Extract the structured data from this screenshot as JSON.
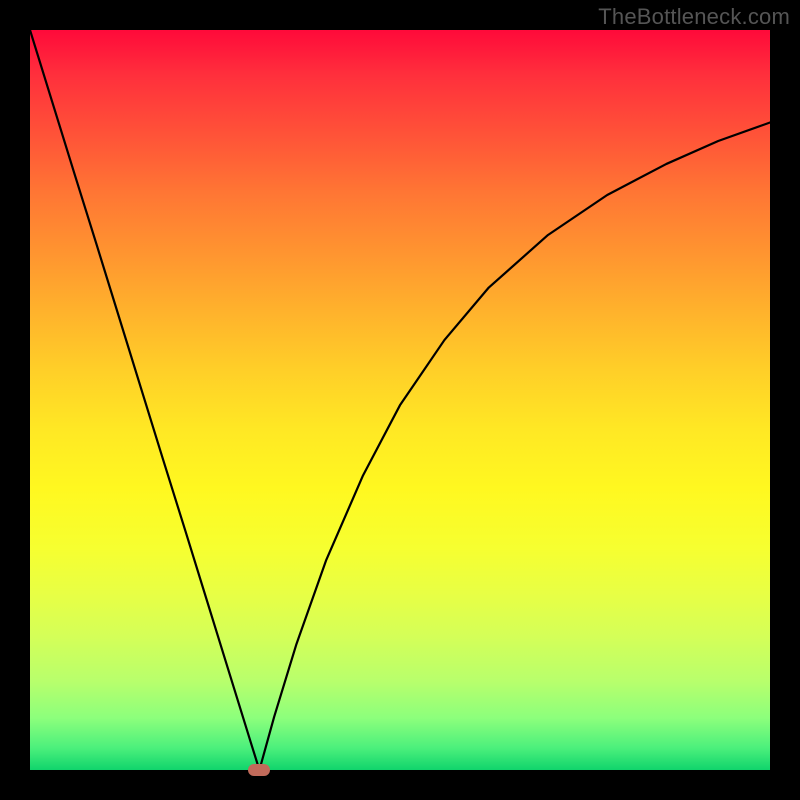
{
  "attribution": "TheBottleneck.com",
  "chart_data": {
    "type": "line",
    "title": "",
    "xlabel": "",
    "ylabel": "",
    "xlim": [
      0,
      100
    ],
    "ylim": [
      0,
      100
    ],
    "grid": false,
    "legend": false,
    "minimum_x": 31,
    "series": [
      {
        "name": "left-branch",
        "x": [
          0,
          3,
          6,
          9,
          12,
          15,
          18,
          21,
          24,
          27,
          30,
          31
        ],
        "values": [
          100,
          90.3,
          80.6,
          71.0,
          61.3,
          51.6,
          41.9,
          32.3,
          22.6,
          12.9,
          3.2,
          0
        ]
      },
      {
        "name": "right-branch",
        "x": [
          31,
          33,
          36,
          40,
          45,
          50,
          56,
          62,
          70,
          78,
          86,
          93,
          100
        ],
        "values": [
          0,
          7.2,
          17.0,
          28.3,
          39.8,
          49.3,
          58.1,
          65.2,
          72.3,
          77.7,
          81.9,
          85.0,
          87.5
        ]
      }
    ],
    "gradient_stops": [
      {
        "pos": 0,
        "color": "#ff0a3a"
      },
      {
        "pos": 50,
        "color": "#ffe824"
      },
      {
        "pos": 100,
        "color": "#10d46c"
      }
    ],
    "marker": {
      "x": 31,
      "y": 0,
      "color": "#c16a5a"
    }
  }
}
